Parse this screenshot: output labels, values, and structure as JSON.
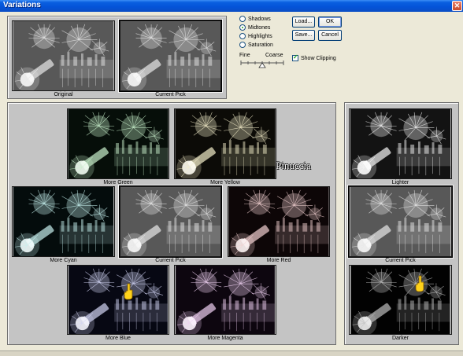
{
  "window": {
    "title": "Variations",
    "close_glyph": "✕"
  },
  "top_previews": {
    "original": "Original",
    "current_pick": "Current Pick"
  },
  "adjust_options": [
    {
      "label": "Shadows",
      "selected": false
    },
    {
      "label": "Midtones",
      "selected": true
    },
    {
      "label": "Highlights",
      "selected": false
    },
    {
      "label": "Saturation",
      "selected": false
    }
  ],
  "fineness": {
    "fine_label": "Fine",
    "coarse_label": "Coarse"
  },
  "buttons": {
    "load": "Load...",
    "ok": "OK",
    "save": "Save...",
    "cancel": "Cancel"
  },
  "show_clipping": {
    "label": "Show Clipping",
    "checked": true
  },
  "color_grid": {
    "more_green": "More Green",
    "more_yellow": "More Yellow",
    "more_cyan": "More Cyan",
    "current_pick": "Current Pick",
    "more_red": "More Red",
    "more_blue": "More Blue",
    "more_magenta": "More Magenta"
  },
  "brightness": {
    "lighter": "Lighter",
    "current_pick": "Current Pick",
    "darker": "Darker"
  },
  "watermark": "Pinuccia",
  "colors": {
    "title_bar": "#0453d8",
    "panel": "#c4c4c4",
    "window_bg": "#ECE9D8"
  }
}
